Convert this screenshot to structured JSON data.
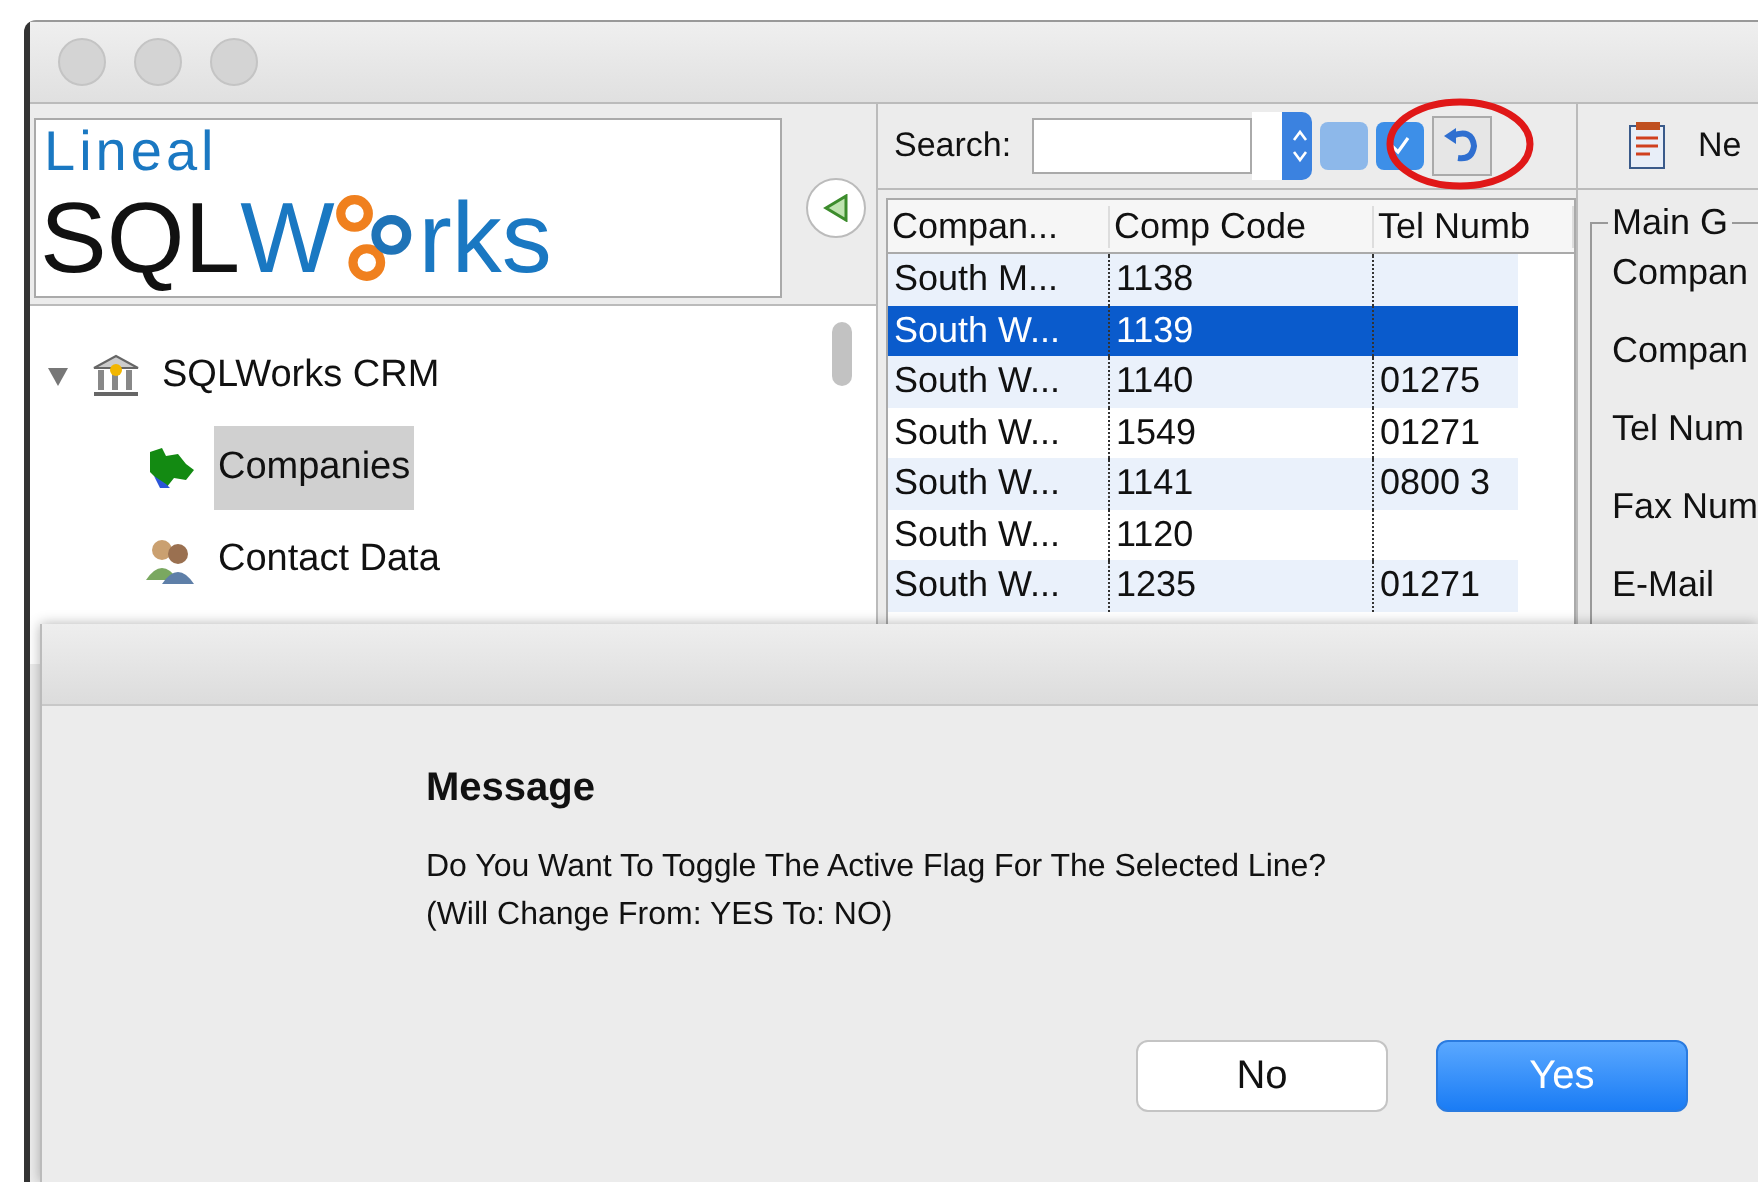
{
  "logo": {
    "top": "Lineal",
    "dark": "SQL",
    "blue": "W",
    "end": "rks"
  },
  "tree": [
    {
      "label": "SQLWorks CRM",
      "expanded": true,
      "children": [
        {
          "label": "Companies",
          "selected": true,
          "kind": "map"
        },
        {
          "label": "Contact Data",
          "selected": false,
          "kind": "people"
        }
      ]
    }
  ],
  "search": {
    "label": "Search:"
  },
  "tool_buttons": [
    {
      "kind": "check",
      "active": false
    },
    {
      "kind": "check",
      "active": true
    },
    {
      "kind": "undo"
    }
  ],
  "new_button": {
    "label": "Ne"
  },
  "table": {
    "columns": [
      "Compan...",
      "Comp Code",
      "Tel Numb"
    ],
    "rows": [
      {
        "cells": [
          "South M...",
          "1138",
          ""
        ],
        "selected": false
      },
      {
        "cells": [
          "South W...",
          "1139",
          ""
        ],
        "selected": true
      },
      {
        "cells": [
          "South W...",
          "1140",
          "01275"
        ],
        "selected": false
      },
      {
        "cells": [
          "South W...",
          "1549",
          "01271"
        ],
        "selected": false
      },
      {
        "cells": [
          "South W...",
          "1141",
          "0800 3"
        ],
        "selected": false
      },
      {
        "cells": [
          "South W...",
          "1120",
          ""
        ],
        "selected": false
      },
      {
        "cells": [
          "South W...",
          "1235",
          "01271"
        ],
        "selected": false
      }
    ]
  },
  "group": {
    "title": "Main G",
    "fields": [
      "Compan",
      "Compan",
      "Tel Num",
      "Fax Num",
      "E-Mail"
    ]
  },
  "dialog": {
    "title": "Message",
    "lines": [
      "Do You Want To Toggle The Active Flag For The Selected Line?",
      "(Will Change From: YES To: NO)"
    ],
    "buttons": [
      {
        "label": "No",
        "default": false
      },
      {
        "label": "Yes",
        "default": true
      }
    ]
  }
}
